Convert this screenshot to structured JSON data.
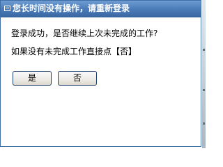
{
  "dialog": {
    "title": "您长时间没有操作，请重新登录",
    "message_line1": "登录成功，是否继续上次未完成的工作?",
    "message_line2": "如果没有未完成工作直接点【否】",
    "yes_label": "是",
    "no_label": "否"
  },
  "colors": {
    "titlebar": "#4a7bb8",
    "border": "#3d6fa6",
    "button_border": "#1d3f6b"
  },
  "icons": {
    "title_icon": "window-icon"
  }
}
